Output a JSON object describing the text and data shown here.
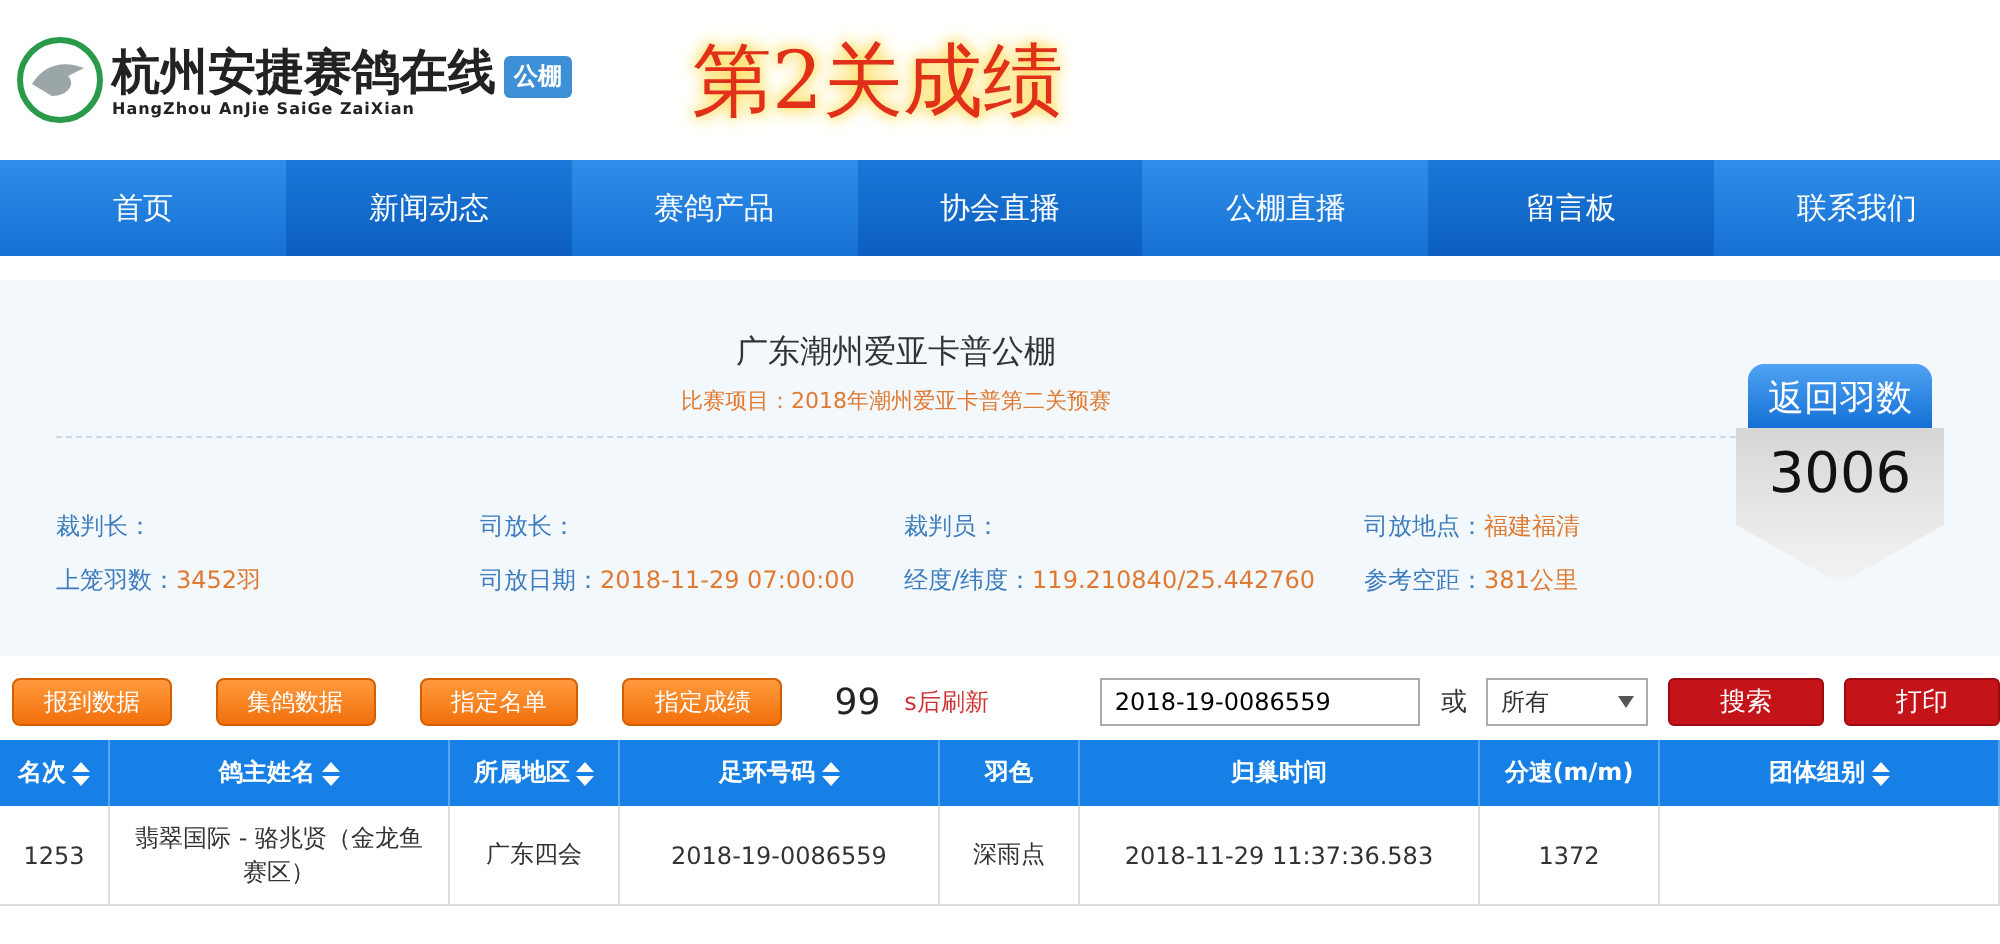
{
  "header": {
    "site_name": "杭州安捷赛鸽在线",
    "pinyin": "HangZhou AnJie SaiGe ZaiXian",
    "badge": "公棚",
    "page_title": "第2关成绩"
  },
  "nav": [
    "首页",
    "新闻动态",
    "赛鸽产品",
    "协会直播",
    "公棚直播",
    "留言板",
    "联系我们"
  ],
  "info": {
    "loft": "广东潮州爱亚卡普公棚",
    "race": "比赛项目：2018年潮州爱亚卡普第二关预赛",
    "fields": [
      {
        "label": "裁判长："
      },
      {
        "label": "司放长："
      },
      {
        "label": "裁判员："
      },
      {
        "label": "司放地点：",
        "value": "福建福清"
      },
      {
        "label": "上笼羽数：",
        "value": "3452羽"
      },
      {
        "label": "司放日期：",
        "value": "2018-11-29 07:00:00"
      },
      {
        "label": "经度/纬度：",
        "value": "119.210840/25.442760"
      },
      {
        "label": "参考空距：",
        "value": "381公里"
      }
    ],
    "returned_label": "返回羽数",
    "returned_count": "3006"
  },
  "toolbar": {
    "buttons": [
      "报到数据",
      "集鸽数据",
      "指定名单",
      "指定成绩"
    ],
    "countdown": "99",
    "countdown_suffix": "s后刷新",
    "search_value": "2018-19-0086559",
    "or": "或",
    "select_value": "所有",
    "actions": [
      "搜索",
      "打印"
    ]
  },
  "table": {
    "columns": [
      {
        "label": "名次",
        "sortable": true
      },
      {
        "label": "鸽主姓名",
        "sortable": true
      },
      {
        "label": "所属地区",
        "sortable": true
      },
      {
        "label": "足环号码",
        "sortable": true
      },
      {
        "label": "羽色",
        "sortable": false
      },
      {
        "label": "归巢时间",
        "sortable": false
      },
      {
        "label": "分速(m/m)",
        "sortable": false
      },
      {
        "label": "团体组别",
        "sortable": true
      }
    ],
    "rows": [
      [
        "1253",
        "翡翠国际 - 骆兆贤（金龙鱼赛区）",
        "广东四会",
        "2018-19-0086559",
        "深雨点",
        "2018-11-29 11:37:36.583",
        "1372"
      ]
    ]
  }
}
